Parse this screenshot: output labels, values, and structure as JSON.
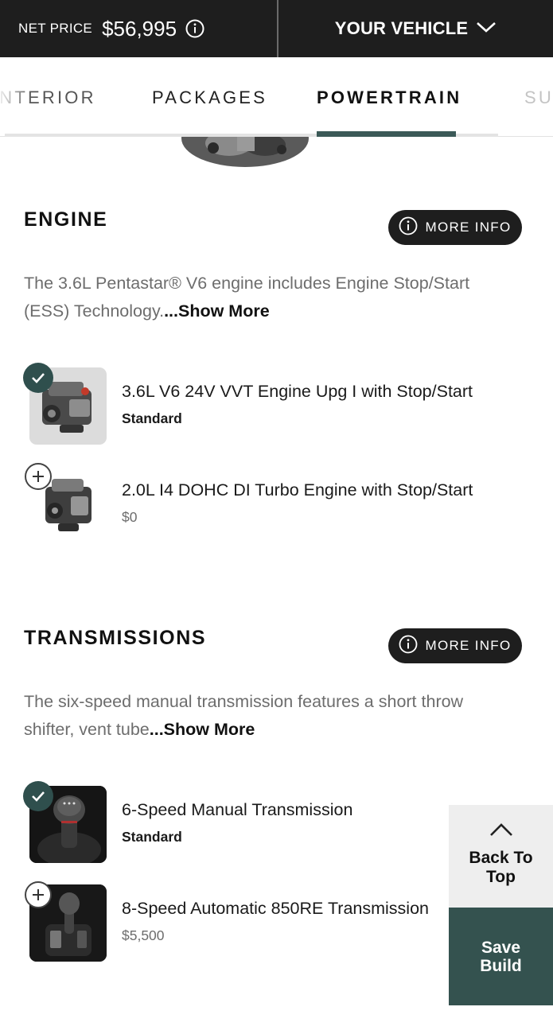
{
  "header": {
    "price_label": "NET PRICE",
    "price_value": "$56,995",
    "vehicle_label": "YOUR VEHICLE"
  },
  "tabs": [
    {
      "label": "INTERIOR",
      "state": "partial"
    },
    {
      "label": "PACKAGES",
      "state": "normal"
    },
    {
      "label": "POWERTRAIN",
      "state": "active"
    },
    {
      "label": "SU",
      "state": "faded"
    }
  ],
  "engine": {
    "title": "ENGINE",
    "more_info_label": "MORE INFO",
    "description_line1": "The 3.6L Pentastar® V6 engine includes Engine Stop/Start",
    "description_line2": "(ESS) Technology.",
    "show_more": "...Show More",
    "options": [
      {
        "name": "3.6L V6 24V VVT Engine Upg I with Stop/Start",
        "sub": "Standard",
        "selected": true
      },
      {
        "name": "2.0L I4 DOHC DI Turbo Engine with Stop/Start",
        "sub": "$0",
        "selected": false
      }
    ]
  },
  "transmissions": {
    "title": "TRANSMISSIONS",
    "more_info_label": "MORE INFO",
    "description_line1": "The six-speed manual transmission features a short throw",
    "description_line2": "shifter, vent tube",
    "show_more": "...Show More",
    "options": [
      {
        "name": "6-Speed Manual Transmission",
        "sub": "Standard",
        "selected": true
      },
      {
        "name": "8-Speed Automatic 850RE Transmission",
        "sub": "$5,500",
        "selected": false
      }
    ]
  },
  "floating": {
    "back_to_top": "Back To Top",
    "save_build": "Save Build"
  },
  "colors": {
    "header_bg": "#1e1e1e",
    "accent_teal": "#2f4f4d",
    "save_bg": "#34524f",
    "back_top_bg": "#eeeeee"
  },
  "icons": [
    "info-icon",
    "chevron-down-icon",
    "checkmark-icon",
    "plus-icon",
    "chevron-up-icon"
  ]
}
